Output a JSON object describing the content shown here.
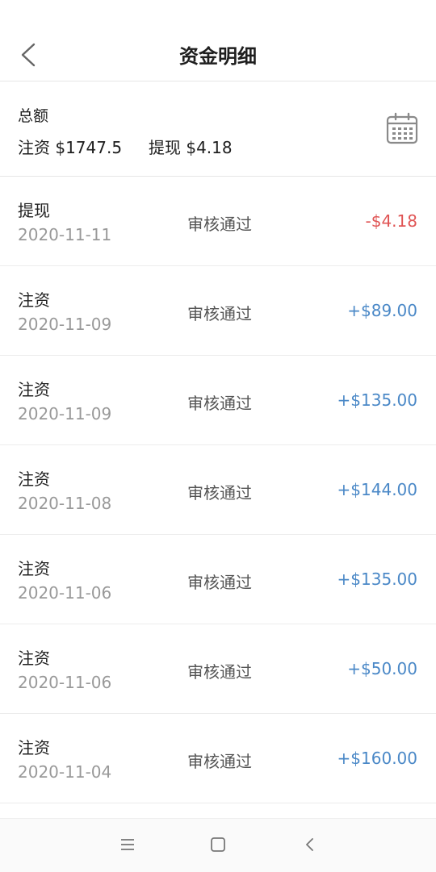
{
  "header": {
    "title": "资金明细",
    "back_icon": "chevron-left-icon"
  },
  "summary": {
    "label": "总额",
    "deposit": "注资 $1747.5",
    "withdraw": "提现 $4.18",
    "calendar_icon": "calendar-icon"
  },
  "colors": {
    "negative": "#e05555",
    "positive": "#4a88c7"
  },
  "records": [
    {
      "type": "提现",
      "date": "2020-11-11",
      "status": "审核通过",
      "amount": "-$4.18",
      "sign": "negative"
    },
    {
      "type": "注资",
      "date": "2020-11-09",
      "status": "审核通过",
      "amount": "+$89.00",
      "sign": "positive"
    },
    {
      "type": "注资",
      "date": "2020-11-09",
      "status": "审核通过",
      "amount": "+$135.00",
      "sign": "positive"
    },
    {
      "type": "注资",
      "date": "2020-11-08",
      "status": "审核通过",
      "amount": "+$144.00",
      "sign": "positive"
    },
    {
      "type": "注资",
      "date": "2020-11-06",
      "status": "审核通过",
      "amount": "+$135.00",
      "sign": "positive"
    },
    {
      "type": "注资",
      "date": "2020-11-06",
      "status": "审核通过",
      "amount": "+$50.00",
      "sign": "positive"
    },
    {
      "type": "注资",
      "date": "2020-11-04",
      "status": "审核通过",
      "amount": "+$160.00",
      "sign": "positive"
    }
  ],
  "navbar": {
    "icons": [
      "menu-icon",
      "home-icon",
      "back-icon"
    ]
  }
}
